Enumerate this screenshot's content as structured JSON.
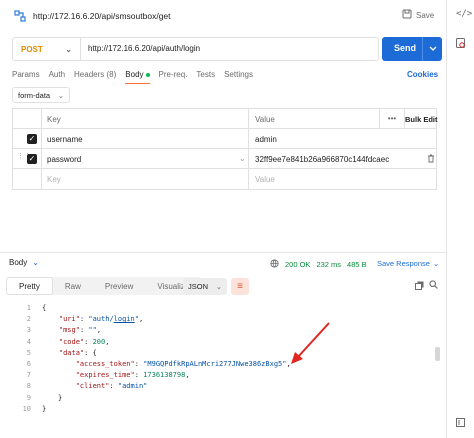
{
  "header": {
    "title": "http://172.16.6.20/api/smsoutbox/get",
    "save_label": "Save"
  },
  "request": {
    "method": "POST",
    "url": "http://172.16.6.20/api/auth/login",
    "send_label": "Send"
  },
  "tabs": [
    {
      "label": "Params"
    },
    {
      "label": "Auth"
    },
    {
      "label": "Headers (8)"
    },
    {
      "label": "Body"
    },
    {
      "label": "Pre-req."
    },
    {
      "label": "Tests"
    },
    {
      "label": "Settings"
    }
  ],
  "cookies_label": "Cookies",
  "body_mode": "form-data",
  "params_table": {
    "headers": {
      "key": "Key",
      "value": "Value",
      "bulk_edit": "Bulk Edit"
    },
    "rows": [
      {
        "key": "username",
        "value": "admin"
      },
      {
        "key": "password",
        "value": "32ff9ee7e841b26a966870c144fdcaec"
      }
    ],
    "placeholder": {
      "key": "Key",
      "value": "Value"
    }
  },
  "response": {
    "section_label": "Body",
    "status": "200 OK",
    "time": "232 ms",
    "size": "485 B",
    "save_response_label": "Save Response",
    "view_tabs": [
      {
        "label": "Pretty"
      },
      {
        "label": "Raw"
      },
      {
        "label": "Preview"
      },
      {
        "label": "Visualize"
      }
    ],
    "format": "JSON",
    "lines": {
      "l1": "{",
      "l2_key": "\"uri\"",
      "l2_val_a": "\"auth/",
      "l2_val_b": "login",
      "l2_val_c": "\"",
      "l3_key": "\"msg\"",
      "l3_val": "\"\"",
      "l4_key": "\"code\"",
      "l4_val": "200",
      "l5_key": "\"data\"",
      "l6_key": "\"access_token\"",
      "l6_val": "\"M9GQPdfkRpALnMcri277JNwe386zBxg5\"",
      "l7_key": "\"expires_time\"",
      "l7_val": "1736138798",
      "l8_key": "\"client\"",
      "l8_val": "\"admin\"",
      "l9": "}",
      "l10": "}"
    },
    "line_numbers": [
      "1",
      "2",
      "3",
      "4",
      "5",
      "6",
      "7",
      "8",
      "9",
      "10"
    ]
  },
  "colors": {
    "accent": "#1c6bd6",
    "method": "#e08a00",
    "arrow": "#e0261f",
    "status_ok": "#0a8a3a"
  }
}
